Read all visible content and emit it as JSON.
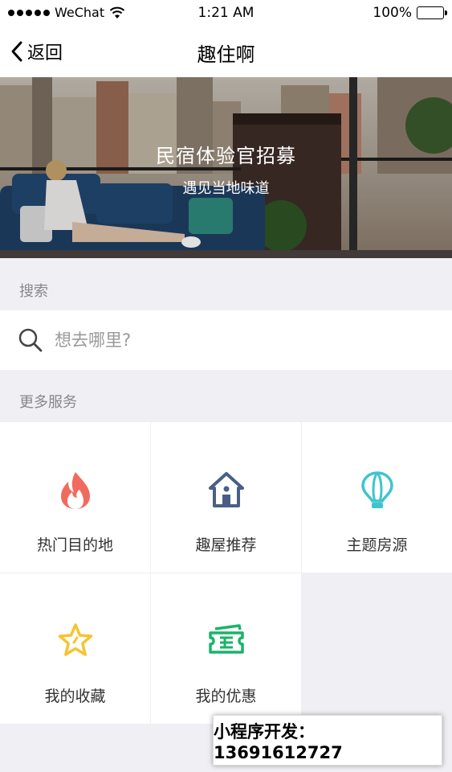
{
  "status_bar": {
    "carrier": "WeChat",
    "time": "1:21 AM",
    "battery": "100%"
  },
  "nav": {
    "back_label": "返回",
    "title": "趣住啊"
  },
  "banner": {
    "title": "民宿体验官招募",
    "subtitle": "遇见当地味道"
  },
  "search": {
    "section_label": "搜索",
    "placeholder": "想去哪里?"
  },
  "services": {
    "section_label": "更多服务",
    "items": [
      {
        "label": "热门目的地",
        "icon": "flame-icon",
        "color": "#f06b5e"
      },
      {
        "label": "趣屋推荐",
        "icon": "house-icon",
        "color": "#4a5f86"
      },
      {
        "label": "主题房源",
        "icon": "hot-air-balloon-icon",
        "color": "#3ec4cf"
      },
      {
        "label": "我的收藏",
        "icon": "star-icon",
        "color": "#f7c430"
      },
      {
        "label": "我的优惠",
        "icon": "ticket-icon",
        "color": "#1bb36a"
      }
    ]
  },
  "promo": {
    "text": "小程序开发：13691612727"
  }
}
